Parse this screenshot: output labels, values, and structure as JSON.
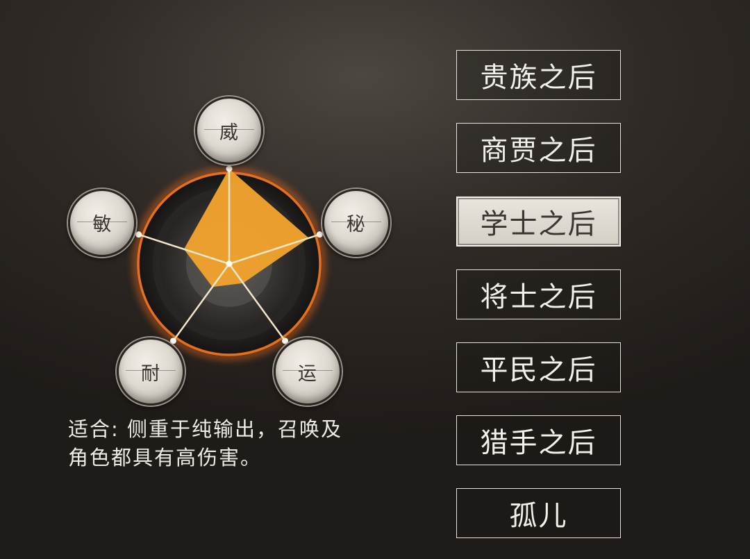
{
  "stats": {
    "wei": "威",
    "mi": "秘",
    "yun": "运",
    "nai": "耐",
    "min": "敏"
  },
  "stat_levels": [
    1.0,
    0.88,
    0.25,
    0.3,
    0.5
  ],
  "description": {
    "line1": "适合: 侧重于纯输出，召唤及",
    "line2": "角色都具有高伤害。"
  },
  "origins": [
    {
      "label": "贵族之后",
      "selected": false
    },
    {
      "label": "商贾之后",
      "selected": false
    },
    {
      "label": "学士之后",
      "selected": true
    },
    {
      "label": "将士之后",
      "selected": false
    },
    {
      "label": "平民之后",
      "selected": false
    },
    {
      "label": "猎手之后",
      "selected": false
    },
    {
      "label": "孤儿",
      "selected": false
    }
  ],
  "colors": {
    "radar_fill": "#f0a22e",
    "ring_glow": "#e0641c",
    "spoke": "#f4e6c8"
  }
}
